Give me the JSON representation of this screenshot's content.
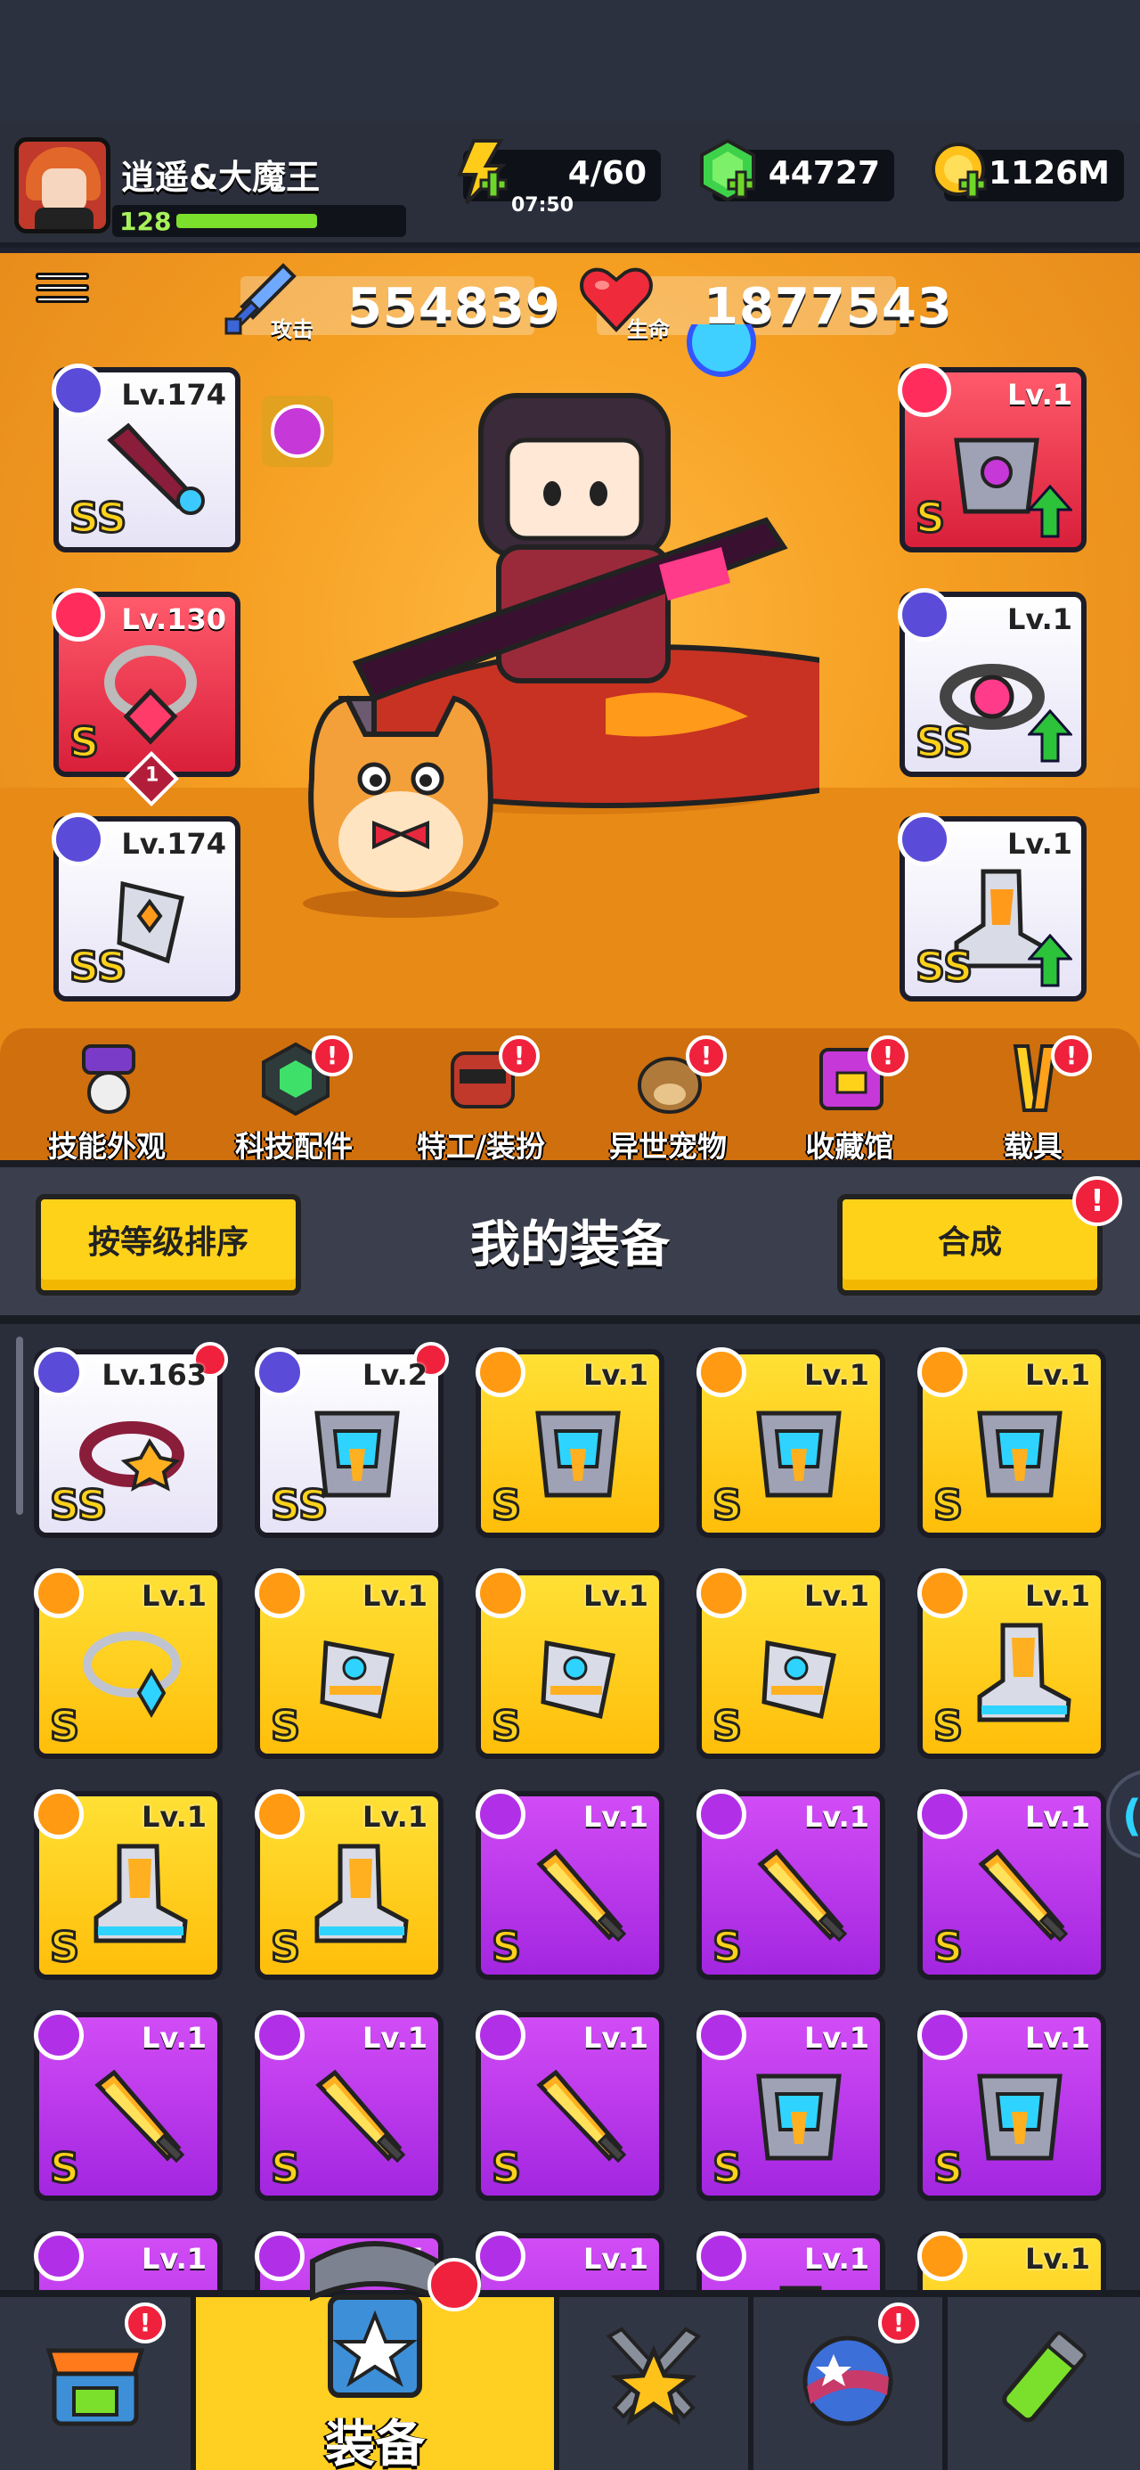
{
  "player": {
    "name": "逍遥&大魔王",
    "level": "128",
    "xp_fraction": 0.75
  },
  "resources": {
    "energy": "4/60",
    "energy_timer": "07:50",
    "gems": "44727",
    "coins": "1126M"
  },
  "stats": {
    "attack_label": "攻击",
    "attack_value": "554839",
    "hp_label": "生命",
    "hp_value": "1877543"
  },
  "equipped_left": [
    {
      "level": "Lv.174",
      "grade": "SS",
      "slot": "weapon",
      "rarity": "white"
    },
    {
      "level": "Lv.130",
      "grade": "S",
      "slot": "necklace",
      "rarity": "red",
      "badge": "1"
    },
    {
      "level": "Lv.174",
      "grade": "SS",
      "slot": "glove",
      "rarity": "white"
    }
  ],
  "equipped_right": [
    {
      "level": "Lv.1",
      "grade": "S",
      "slot": "armor",
      "rarity": "red",
      "upgrade": true
    },
    {
      "level": "Lv.1",
      "grade": "SS",
      "slot": "belt",
      "rarity": "white",
      "upgrade": true
    },
    {
      "level": "Lv.1",
      "grade": "SS",
      "slot": "boots",
      "rarity": "white",
      "upgrade": true
    }
  ],
  "shortcuts": [
    {
      "label": "技能外观",
      "icon": "skill-skin-icon",
      "alert": false
    },
    {
      "label": "科技配件",
      "icon": "tech-parts-icon",
      "alert": true
    },
    {
      "label": "特工/装扮",
      "icon": "agent-outfit-icon",
      "alert": true
    },
    {
      "label": "异世宠物",
      "icon": "pet-icon",
      "alert": true
    },
    {
      "label": "收藏馆",
      "icon": "collection-icon",
      "alert": true
    },
    {
      "label": "载具",
      "icon": "vehicle-icon",
      "alert": true
    }
  ],
  "equipment_bar": {
    "sort_label": "按等级排序",
    "title": "我的装备",
    "merge_label": "合成",
    "merge_alert": "!"
  },
  "alert_mark": "!",
  "inventory": [
    {
      "level": "Lv.163",
      "grade": "SS",
      "rarity": "white",
      "slot": "belt",
      "corner": true
    },
    {
      "level": "Lv.2",
      "grade": "SS",
      "rarity": "white",
      "slot": "armor",
      "corner": true
    },
    {
      "level": "Lv.1",
      "grade": "S",
      "rarity": "gold",
      "slot": "armor"
    },
    {
      "level": "Lv.1",
      "grade": "S",
      "rarity": "gold",
      "slot": "armor"
    },
    {
      "level": "Lv.1",
      "grade": "S",
      "rarity": "gold",
      "slot": "armor"
    },
    {
      "level": "Lv.1",
      "grade": "S",
      "rarity": "gold",
      "slot": "necklace"
    },
    {
      "level": "Lv.1",
      "grade": "S",
      "rarity": "gold",
      "slot": "glove"
    },
    {
      "level": "Lv.1",
      "grade": "S",
      "rarity": "gold",
      "slot": "glove"
    },
    {
      "level": "Lv.1",
      "grade": "S",
      "rarity": "gold",
      "slot": "glove"
    },
    {
      "level": "Lv.1",
      "grade": "S",
      "rarity": "gold",
      "slot": "boots"
    },
    {
      "level": "Lv.1",
      "grade": "S",
      "rarity": "gold",
      "slot": "boots"
    },
    {
      "level": "Lv.1",
      "grade": "S",
      "rarity": "gold",
      "slot": "boots"
    },
    {
      "level": "Lv.1",
      "grade": "S",
      "rarity": "purple",
      "slot": "weapon"
    },
    {
      "level": "Lv.1",
      "grade": "S",
      "rarity": "purple",
      "slot": "weapon"
    },
    {
      "level": "Lv.1",
      "grade": "S",
      "rarity": "purple",
      "slot": "weapon"
    },
    {
      "level": "Lv.1",
      "grade": "S",
      "rarity": "purple",
      "slot": "weapon"
    },
    {
      "level": "Lv.1",
      "grade": "S",
      "rarity": "purple",
      "slot": "weapon"
    },
    {
      "level": "Lv.1",
      "grade": "S",
      "rarity": "purple",
      "slot": "weapon"
    },
    {
      "level": "Lv.1",
      "grade": "S",
      "rarity": "purple",
      "slot": "armor"
    },
    {
      "level": "Lv.1",
      "grade": "S",
      "rarity": "purple",
      "slot": "armor"
    },
    {
      "level": "Lv.1",
      "grade": "",
      "rarity": "purple",
      "slot": "armor"
    },
    {
      "level": "Lv.1",
      "grade": "",
      "rarity": "purple",
      "slot": "weapon"
    },
    {
      "level": "Lv.1",
      "grade": "",
      "rarity": "purple",
      "slot": "belt"
    },
    {
      "level": "Lv.1",
      "grade": "",
      "rarity": "purple",
      "slot": "boots"
    },
    {
      "level": "Lv.1",
      "grade": "",
      "rarity": "gold",
      "slot": "glove"
    }
  ],
  "bottom_nav": [
    {
      "name": "shop",
      "label": "",
      "icon": "shop-icon",
      "alert": true,
      "active": false
    },
    {
      "name": "equipment",
      "label": "装备",
      "icon": "equipment-icon",
      "alert": true,
      "active": true
    },
    {
      "name": "skills",
      "label": "",
      "icon": "crossed-swords-star-icon",
      "alert": false,
      "active": false
    },
    {
      "name": "world",
      "label": "",
      "icon": "planet-icon",
      "alert": true,
      "active": false
    },
    {
      "name": "lab",
      "label": "",
      "icon": "dna-tube-icon",
      "alert": false,
      "active": false
    }
  ],
  "colors": {
    "gold_rarity": "#ffc812",
    "purple_rarity": "#b42fe8",
    "white_rarity": "#ffffff",
    "red_rarity": "#e8283f",
    "accent": "#ffd21a",
    "alert": "#f0213c"
  }
}
